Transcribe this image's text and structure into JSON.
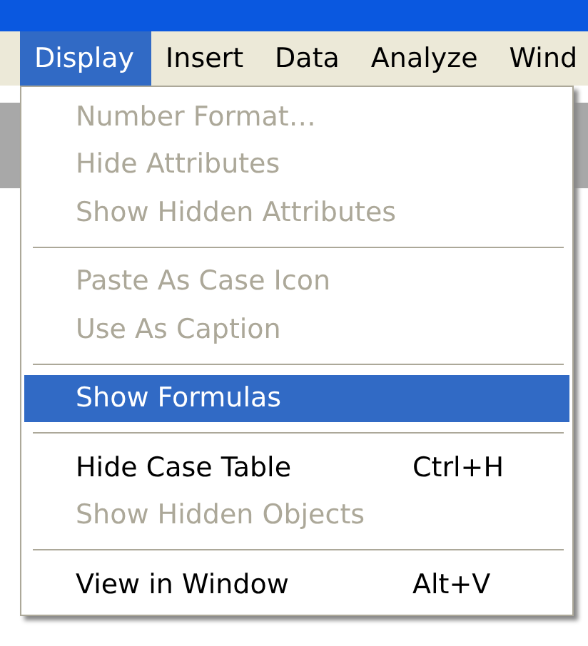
{
  "menubar": [
    {
      "label": "Display",
      "selected": true
    },
    {
      "label": "Insert",
      "selected": false
    },
    {
      "label": "Data",
      "selected": false
    },
    {
      "label": "Analyze",
      "selected": false
    },
    {
      "label": "Wind",
      "selected": false
    }
  ],
  "menu": [
    {
      "kind": "item",
      "label": "Number Format…",
      "disabled": true,
      "selected": false
    },
    {
      "kind": "item",
      "label": "Hide Attributes",
      "disabled": true,
      "selected": false
    },
    {
      "kind": "item",
      "label": "Show Hidden Attributes",
      "disabled": true,
      "selected": false
    },
    {
      "kind": "separator"
    },
    {
      "kind": "item",
      "label": "Paste As Case Icon",
      "disabled": true,
      "selected": false
    },
    {
      "kind": "item",
      "label": "Use As Caption",
      "disabled": true,
      "selected": false
    },
    {
      "kind": "separator"
    },
    {
      "kind": "item",
      "label": "Show Formulas",
      "disabled": false,
      "selected": true
    },
    {
      "kind": "separator"
    },
    {
      "kind": "item",
      "label": "Hide Case Table",
      "shortcut": "Ctrl+H",
      "disabled": false,
      "selected": false
    },
    {
      "kind": "item",
      "label": "Show Hidden Objects",
      "disabled": true,
      "selected": false
    },
    {
      "kind": "separator"
    },
    {
      "kind": "item",
      "label": "View in Window",
      "shortcut": "Alt+V",
      "disabled": false,
      "selected": false
    }
  ]
}
